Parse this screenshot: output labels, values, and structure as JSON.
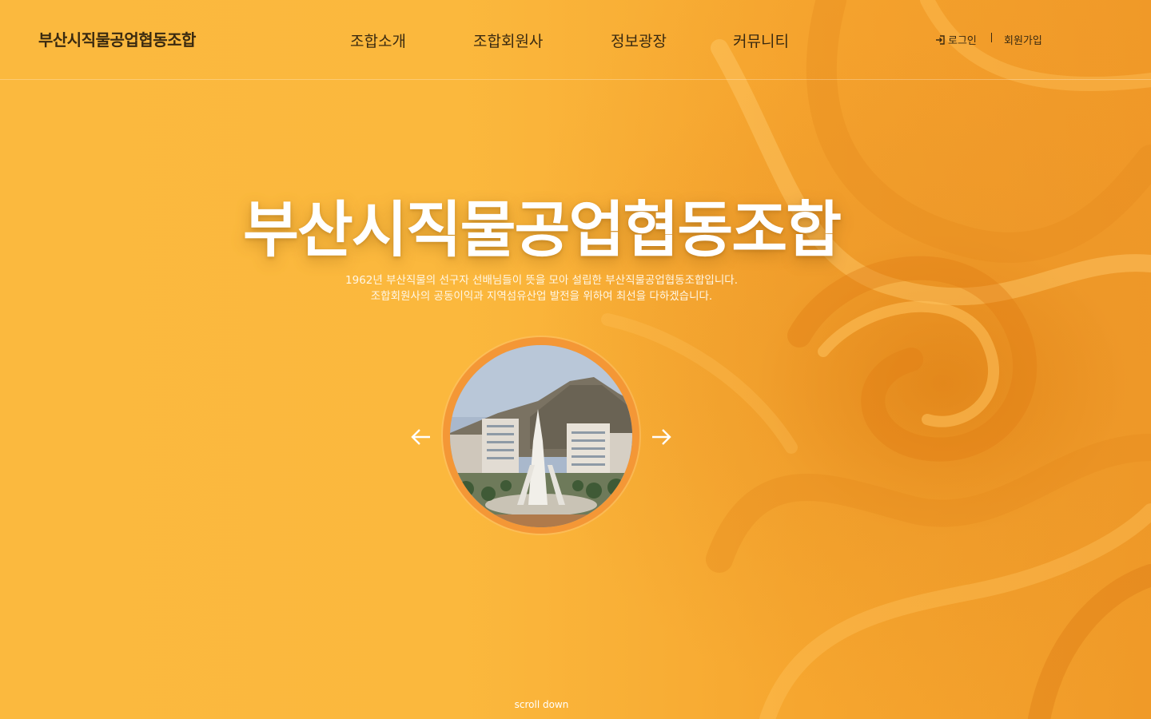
{
  "brand": {
    "name": "부산시직물공업협동조합"
  },
  "nav": {
    "items": [
      "조합소개",
      "조합회원사",
      "정보광장",
      "커뮤니티"
    ]
  },
  "util": {
    "login": "로그인",
    "join": "회원가입"
  },
  "hero": {
    "title": "부산시직물공업협동조합",
    "desc_line1": "1962년 부산직물의 선구자 선배님들이 뜻을 모아 설립한 부산직물공업협동조합입니다.",
    "desc_line2": "조합회원사의 공동이익과 지역섬유산업 발전을 위하여 최선을 다하겠습니다.",
    "scroll": "scroll down"
  },
  "colors": {
    "background": "#fbb93e",
    "frame": "#f49736",
    "text_dark": "#3a2a10"
  },
  "icons": {
    "login": "login-icon",
    "prev": "arrow-left-icon",
    "next": "arrow-right-icon"
  }
}
